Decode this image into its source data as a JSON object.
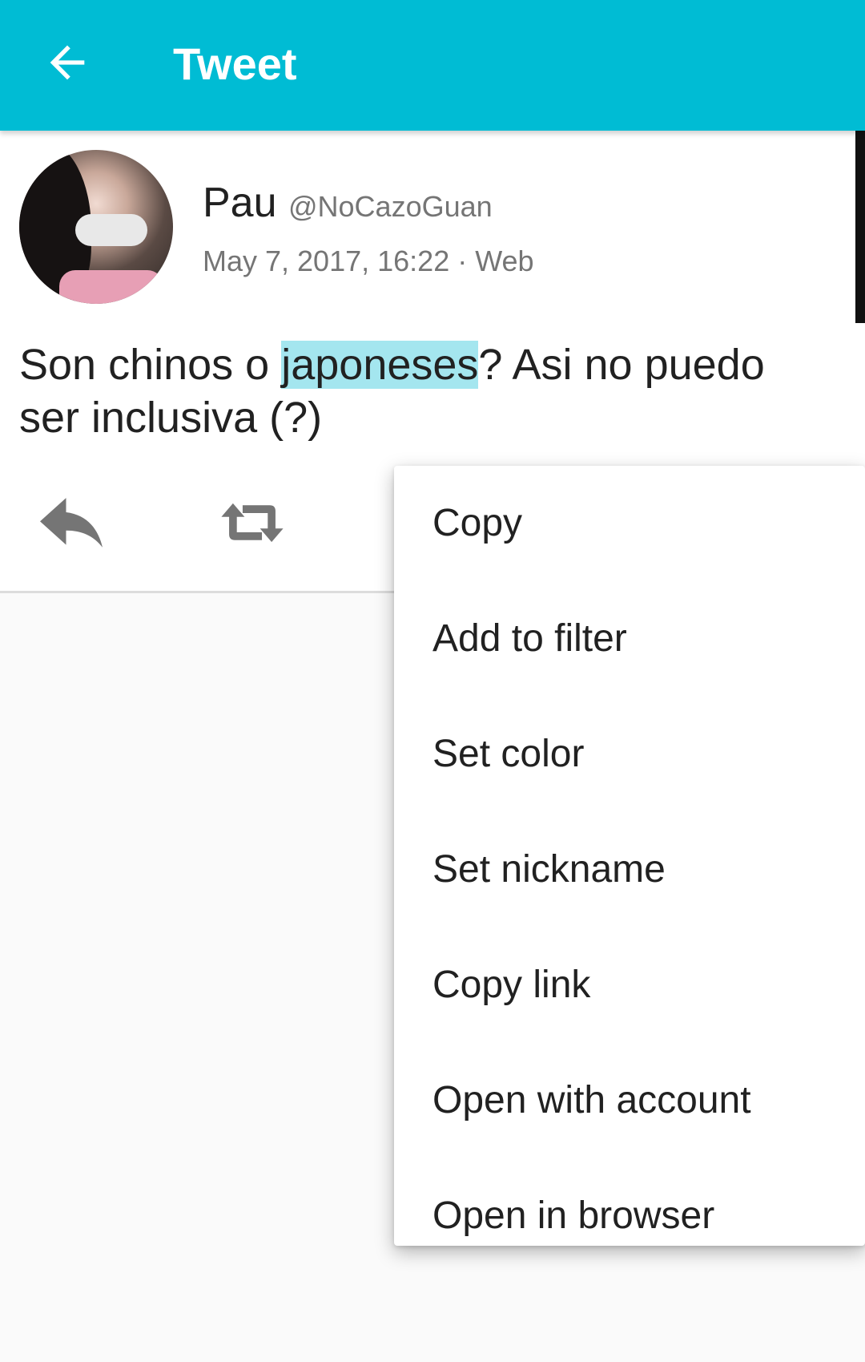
{
  "appbar": {
    "title": "Tweet",
    "back_icon": "arrow-left-icon",
    "color": "#00bcd4"
  },
  "tweet": {
    "user_name": "Pau",
    "user_handle": "@NoCazoGuan",
    "meta": "May 7, 2017, 16:22 · Web",
    "text_before": "Son chinos o ",
    "text_selected": "japoneses",
    "text_after": "? Asi no puedo ser inclusiva (?)",
    "selection_color": "#a4e6ef",
    "actions": {
      "reply_icon": "reply-icon",
      "retweet_icon": "retweet-icon"
    }
  },
  "context_menu": {
    "items": [
      {
        "label": "Copy"
      },
      {
        "label": "Add to filter"
      },
      {
        "label": "Set color"
      },
      {
        "label": "Set nickname"
      },
      {
        "label": "Copy link"
      },
      {
        "label": "Open with account"
      },
      {
        "label": "Open in browser"
      }
    ]
  }
}
